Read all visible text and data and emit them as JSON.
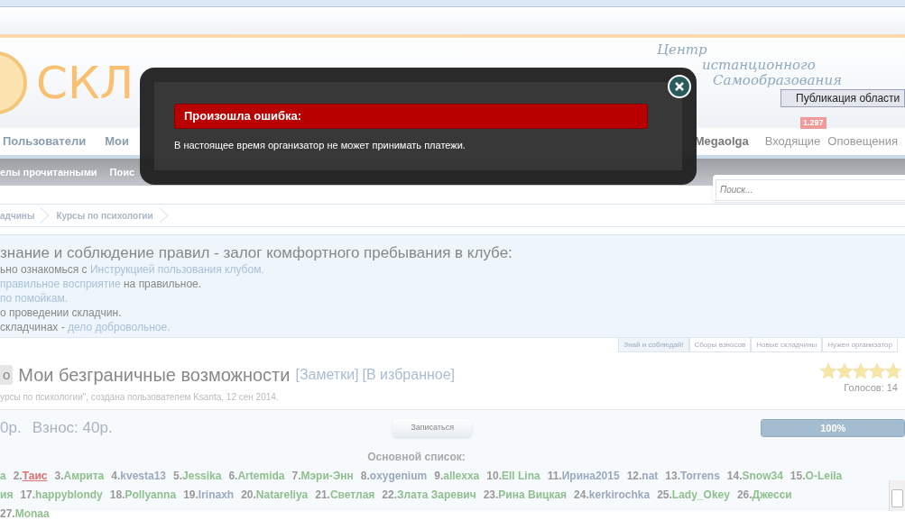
{
  "header": {
    "logo_text": "СКЛ",
    "tagline": [
      "Центр",
      "истанционного",
      "Самообразования"
    ],
    "tooltip": "Публикация области",
    "badge": "1.297"
  },
  "nav": {
    "left": [
      "Пользователи",
      "Мои"
    ],
    "user": "Megaolga",
    "links": [
      "Входящие",
      "Оповещения"
    ]
  },
  "subnav": [
    "елы прочитанными",
    "Поис"
  ],
  "search": {
    "placeholder": "Поиск..."
  },
  "breadcrumbs": [
    "адчины",
    "Курсы по психологии"
  ],
  "notice": {
    "heading": "знание и соблюдение правил - залог комфортного пребывания в клубе:",
    "lines": [
      [
        {
          "text": "ьно ознакомься с ",
          "link": false
        },
        {
          "text": "Инструкцией пользования клубом.",
          "link": true
        }
      ],
      [
        {
          "text": "правильное восприятие",
          "link": true
        },
        {
          "text": " на правильное.",
          "link": false
        }
      ],
      [
        {
          "text": "по помойкам.",
          "link": true
        }
      ],
      [
        {
          "text": "о проведении складчин.",
          "link": false
        }
      ],
      [
        {
          "text": "складчинах - ",
          "link": false
        },
        {
          "text": "дело добровольное.",
          "link": true
        }
      ]
    ]
  },
  "tabs": [
    {
      "label": "Знай и соблюдай!",
      "selected": true
    },
    {
      "label": "Сборы взносов",
      "selected": false
    },
    {
      "label": "Новые складчины",
      "selected": false
    },
    {
      "label": "Нужен организатор",
      "selected": false
    }
  ],
  "thread": {
    "prefix": "о",
    "title": "Мои безграничные возможности",
    "links": [
      "[Заметки]",
      "[В избранное]"
    ],
    "meta": "урсы по психологии\", создана пользователем Ksanta, 12 сен 2014.",
    "stars": 5,
    "votes": "Голосов: 14"
  },
  "funding": {
    "amount": "0р.",
    "fee": "Взнос: 40р.",
    "button": "Записаться",
    "level": 1,
    "progress_label": "100%"
  },
  "list": {
    "title": "Основной список:",
    "participants": [
      {
        "name": "а",
        "color": "#8fbf8f",
        "underlined": false
      },
      {
        "num": "2.",
        "name": "Таис",
        "color": "#e07070",
        "underlined": true
      },
      {
        "num": "3.",
        "name": "Амрита",
        "color": "#8fbf8f",
        "underlined": false
      },
      {
        "num": "4.",
        "name": "kvesta13",
        "color": "#9aa8c0",
        "underlined": false
      },
      {
        "num": "5.",
        "name": "Jessika",
        "color": "#8fbf8f",
        "underlined": false
      },
      {
        "num": "6.",
        "name": "Artemida",
        "color": "#8fbf8f",
        "underlined": false
      },
      {
        "num": "7.",
        "name": "Мэри-Энн",
        "color": "#8fbf8f",
        "underlined": false
      },
      {
        "num": "8.",
        "name": "oxygenium",
        "color": "#9aa8c0",
        "underlined": false
      },
      {
        "num": "9.",
        "name": "allexxa",
        "color": "#8fbf8f",
        "underlined": false
      },
      {
        "num": "10.",
        "name": "Ell Lina",
        "color": "#8fbf8f",
        "underlined": false
      },
      {
        "num": "11.",
        "name": "Ирина2015",
        "color": "#9aa8c0",
        "underlined": false
      },
      {
        "num": "12.",
        "name": "nat",
        "color": "#9aa8c0",
        "underlined": false
      },
      {
        "num": "13.",
        "name": "Torrens",
        "color": "#9aa8c0",
        "underlined": false
      },
      {
        "num": "14.",
        "name": "Snow34",
        "color": "#8fbf8f",
        "underlined": false
      },
      {
        "num": "15.",
        "name": "O-Leila",
        "color": "#8fbf8f",
        "underlined": false
      },
      {
        "name": "ия",
        "color": "#8fbf8f",
        "underlined": false
      },
      {
        "num": "17.",
        "name": "happyblondy",
        "color": "#8fbf8f",
        "underlined": false
      },
      {
        "num": "18.",
        "name": "Pollyanna",
        "color": "#8fbf8f",
        "underlined": false
      },
      {
        "num": "19.",
        "name": "Irinaxh",
        "color": "#9aa8c0",
        "underlined": false
      },
      {
        "num": "20.",
        "name": "Natareliya",
        "color": "#8fbf8f",
        "underlined": false
      },
      {
        "num": "21.",
        "name": "Светлая",
        "color": "#8fbf8f",
        "underlined": false
      },
      {
        "num": "22.",
        "name": "Злата Заревич",
        "color": "#8fbf8f",
        "underlined": false
      },
      {
        "num": "23.",
        "name": "Рина Вицкая",
        "color": "#8fbf8f",
        "underlined": false
      },
      {
        "num": "24.",
        "name": "kerkirochka",
        "color": "#9aa8c0",
        "underlined": false
      },
      {
        "num": "25.",
        "name": "Lady_Okey",
        "color": "#8fbf8f",
        "underlined": false
      },
      {
        "num": "26.",
        "name": "Джесси",
        "color": "#8fbf8f",
        "underlined": false
      },
      {
        "num": "27.",
        "name": "Monaa",
        "color": "#8fbf8f",
        "underlined": false
      }
    ]
  },
  "dialog": {
    "title": "Произошла ошибка:",
    "message": "В настоящее время организатор не может принимать платежи."
  }
}
